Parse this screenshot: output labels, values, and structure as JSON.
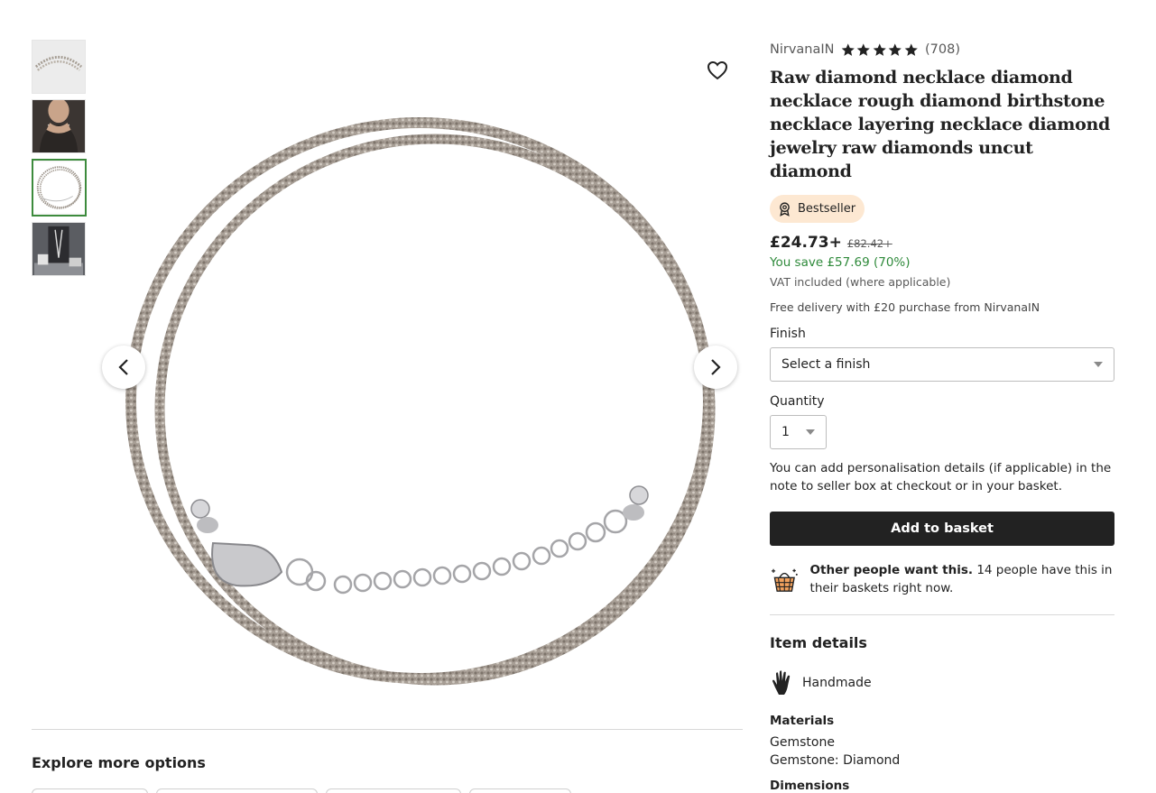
{
  "thumbnails": [
    {
      "name": "thumbnail-1"
    },
    {
      "name": "thumbnail-2"
    },
    {
      "name": "thumbnail-3",
      "selected": true
    },
    {
      "name": "thumbnail-4"
    }
  ],
  "listing": {
    "shop_name": "NirvanaIN",
    "rating": 5,
    "review_count": "(708)",
    "title": "Raw diamond necklace diamond necklace rough diamond birthstone necklace layering necklace diamond jewelry raw diamonds uncut diamond",
    "badge": "Bestseller",
    "price": "£24.73+",
    "original_price": "£82.42+",
    "savings": "You save £57.69 (70%)",
    "vat": "VAT included (where applicable)",
    "delivery": "Free delivery with £20 purchase from NirvanaIN"
  },
  "options": {
    "finish_label": "Finish",
    "finish_placeholder": "Select a finish",
    "quantity_label": "Quantity",
    "quantity_value": "1",
    "personalisation_note": "You can add personalisation details (if applicable) in the note to seller box at checkout or in your basket."
  },
  "actions": {
    "add_to_basket": "Add to basket"
  },
  "demand": {
    "bold": "Other people want this.",
    "text": " 14 people have this in their baskets right now."
  },
  "details": {
    "heading": "Item details",
    "handmade": "Handmade",
    "materials_heading": "Materials",
    "materials": [
      "Gemstone",
      "Gemstone: Diamond"
    ],
    "dimensions_heading": "Dimensions"
  },
  "explore": {
    "title": "Explore more options"
  },
  "colors": {
    "accent_green": "#2f8a3b",
    "badge_bg": "#fde8d2",
    "button_bg": "#222222"
  }
}
